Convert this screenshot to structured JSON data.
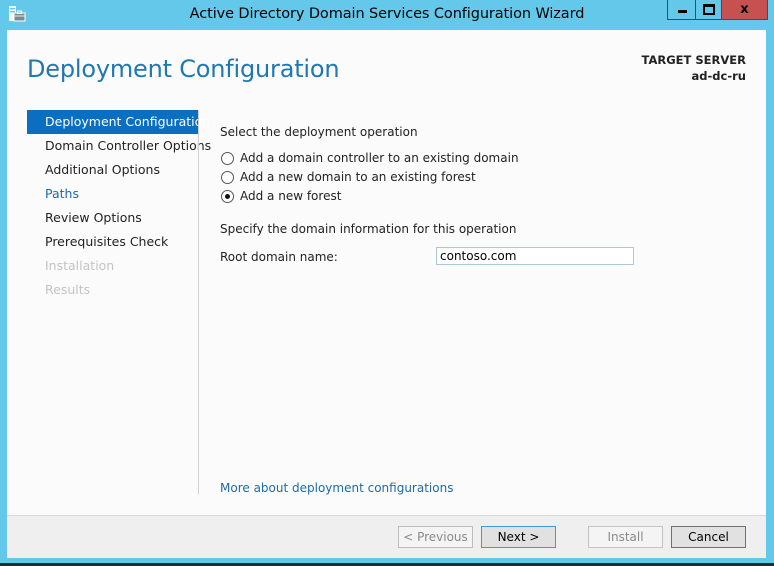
{
  "window": {
    "title": "Active Directory Domain Services Configuration Wizard",
    "icon": "server-toolbox-icon",
    "controls": {
      "minimize": "minimize-icon",
      "maximize": "maximize-icon",
      "close": "close-icon"
    }
  },
  "header": {
    "page_title": "Deployment Configuration",
    "target_server_label": "TARGET SERVER",
    "target_server_value": "ad-dc-ru"
  },
  "nav": {
    "items": [
      {
        "label": "Deployment Configuration",
        "state": "selected"
      },
      {
        "label": "Domain Controller Options",
        "state": "normal"
      },
      {
        "label": "Additional Options",
        "state": "normal"
      },
      {
        "label": "Paths",
        "state": "link"
      },
      {
        "label": "Review Options",
        "state": "normal"
      },
      {
        "label": "Prerequisites Check",
        "state": "normal"
      },
      {
        "label": "Installation",
        "state": "disabled"
      },
      {
        "label": "Results",
        "state": "disabled"
      }
    ]
  },
  "main": {
    "operation_heading": "Select the deployment operation",
    "operations": [
      {
        "label": "Add a domain controller to an existing domain",
        "checked": false
      },
      {
        "label": "Add a new domain to an existing forest",
        "checked": false
      },
      {
        "label": "Add a new forest",
        "checked": true
      }
    ],
    "domain_info_heading": "Specify the domain information for this operation",
    "root_domain_label": "Root domain name:",
    "root_domain_value": "contoso.com",
    "help_link": "More about deployment configurations"
  },
  "footer": {
    "previous_label": "< Previous",
    "next_label": "Next >",
    "install_label": "Install",
    "cancel_label": "Cancel"
  },
  "colors": {
    "window_frame": "#63c8e9",
    "close_button": "#c75050",
    "accent_title": "#1f79b0",
    "nav_selected": "#0a6fc0",
    "link": "#1f6aa8",
    "disabled_text": "#c4c4c4"
  }
}
